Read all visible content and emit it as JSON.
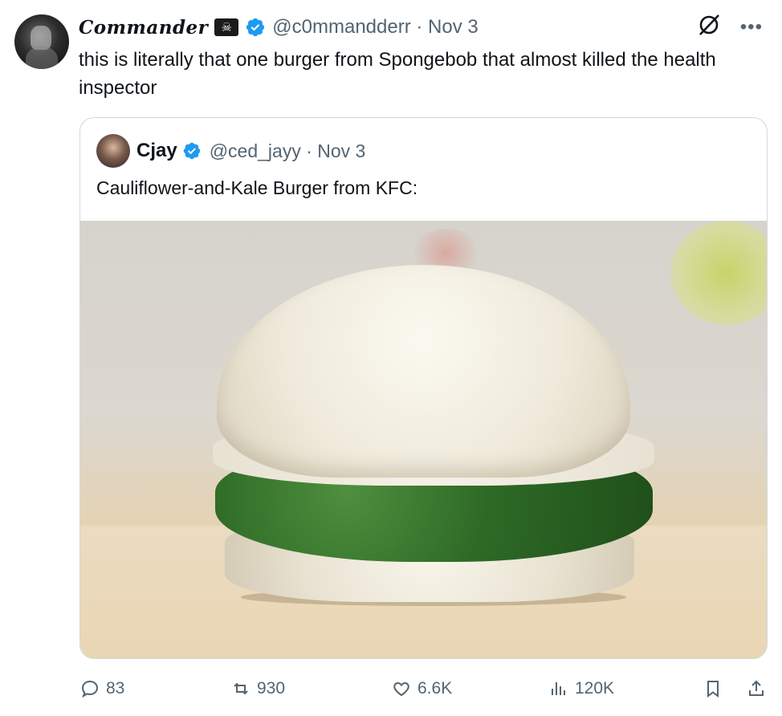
{
  "tweet": {
    "display_name": "Commander",
    "badge_icon": "skull-crossbones-icon",
    "handle": "@c0mmandderr",
    "date": "· Nov 3",
    "text": "this is literally that one burger from Spongebob that almost killed the health inspector"
  },
  "quoted": {
    "display_name": "Cjay",
    "handle": "@ced_jayy",
    "date": "· Nov 3",
    "text": "Cauliflower-and-Kale Burger from KFC:"
  },
  "actions": {
    "replies": "83",
    "retweets": "930",
    "likes": "6.6K",
    "views": "120K"
  },
  "colors": {
    "verified": "#1d9bf0",
    "muted": "#536471",
    "text": "#0f1419",
    "border": "#cfd9de"
  }
}
